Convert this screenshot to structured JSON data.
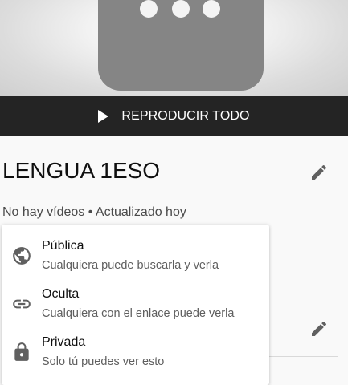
{
  "player": {
    "play_all_label": "REPRODUCIR TODO",
    "play_icon": "play-icon"
  },
  "playlist": {
    "title": "LENGUA 1ESO",
    "meta": "No hay vídeos • Actualizado hoy",
    "edit_icon": "pencil-icon"
  },
  "visibility_menu": {
    "options": [
      {
        "label": "Pública",
        "description": "Cualquiera puede buscarla y verla",
        "icon": "globe-icon"
      },
      {
        "label": "Oculta",
        "description": "Cualquiera con el enlace puede verla",
        "icon": "link-icon"
      },
      {
        "label": "Privada",
        "description": "Solo tú puedes ver esto",
        "icon": "lock-icon"
      }
    ]
  },
  "colors": {
    "play_bar_bg": "#242424",
    "icon_gray": "#606060",
    "text_primary": "#0f0f0f",
    "text_secondary": "#5f5f5f"
  }
}
